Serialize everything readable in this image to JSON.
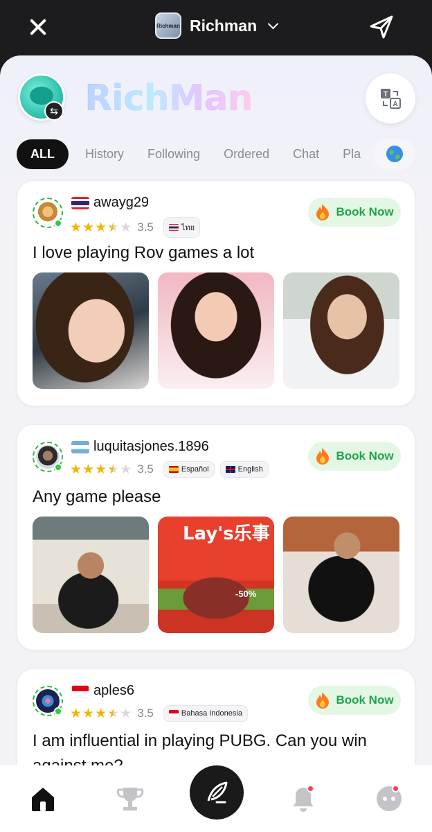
{
  "header": {
    "title": "Richman",
    "app_thumb_text": "Richman"
  },
  "profile": {
    "brand": "RichMan"
  },
  "tabs": [
    "ALL",
    "History",
    "Following",
    "Ordered",
    "Chat",
    "Pla"
  ],
  "cards": [
    {
      "username": "awayg29",
      "rating": "3.5",
      "rating_value": 3.5,
      "languages": [
        "ไทย"
      ],
      "book_label": "Book Now",
      "text": "I love playing Rov games a lot"
    },
    {
      "username": "luquitasjones.1896",
      "rating": "3.5",
      "rating_value": 3.5,
      "languages": [
        "Español",
        "English"
      ],
      "book_label": "Book Now",
      "text": "Any game please"
    },
    {
      "username": "aples6",
      "rating": "3.5",
      "rating_value": 3.5,
      "languages": [
        "Bahasa Indonesia"
      ],
      "book_label": "Book Now",
      "text": "I am influential in playing PUBG. Can you win against me?"
    }
  ],
  "photo_texts": {
    "lays_brand": "Lay's乐事",
    "lays_discount": "-50%"
  },
  "colors": {
    "accent_green": "#1ca44a",
    "book_bg": "#e4f7e4",
    "star": "#f5b400",
    "notify_dot": "#ff3b57"
  },
  "nav": {
    "items": [
      "home-icon",
      "trophy-icon",
      "compose-icon",
      "bell-icon",
      "profile-icon"
    ]
  }
}
